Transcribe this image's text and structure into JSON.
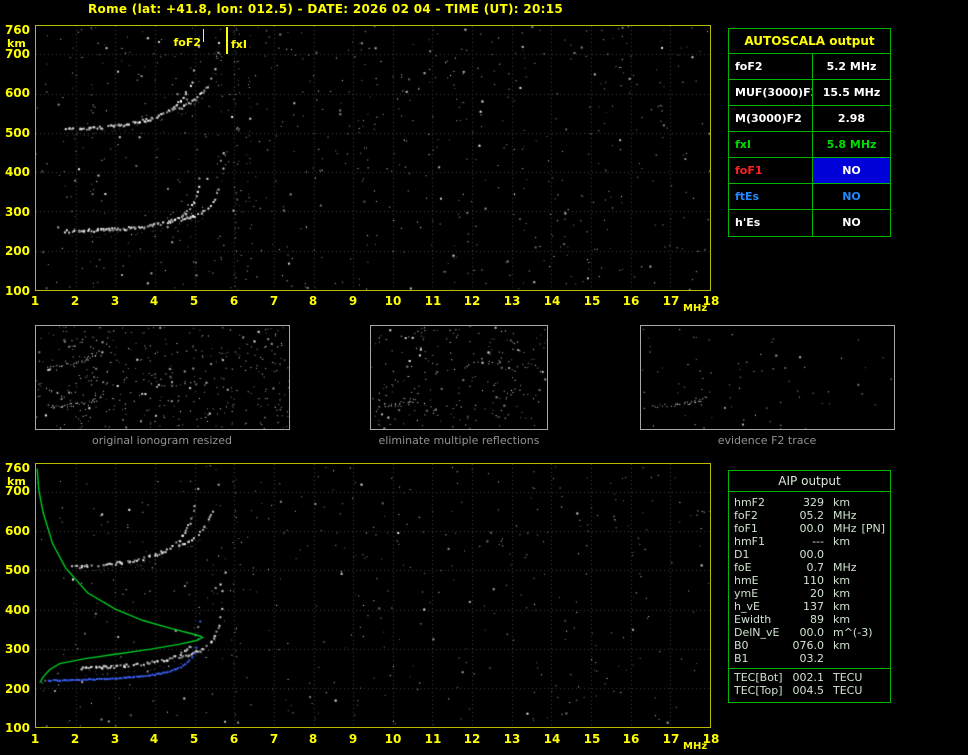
{
  "header": {
    "title": "Rome (lat: +41.8, lon: 012.5) - DATE: 2026 02 04 - TIME (UT): 20:15"
  },
  "colors": {
    "axis_yellow": "#ffff00",
    "plot_border": "#b9b900",
    "table_green": "#00b400",
    "trace_white": "#ffffff",
    "profile_green": "#00cc22",
    "fitted_blue": "#3c64ff",
    "fof1_red": "#ff2020",
    "es_blue": "#2288ff",
    "no_highlight_bg": "#0000d8",
    "caption_gray": "#929292",
    "aip_text": "#cfe2cf"
  },
  "axes": {
    "y_ticks": [
      760,
      700,
      600,
      500,
      400,
      300,
      200,
      100
    ],
    "y_unit": "km",
    "x_ticks": [
      1,
      2,
      3,
      4,
      5,
      6,
      7,
      8,
      9,
      10,
      11,
      12,
      13,
      14,
      15,
      16,
      17,
      18
    ],
    "x_unit": "MHz"
  },
  "top_plot": {
    "foF2_label": "foF2",
    "fxI_label": "fxI"
  },
  "autoscala": {
    "title": "AUTOSCALA output",
    "rows": [
      {
        "label": "foF2",
        "value": "5.2 MHz",
        "label_color": "#ffffff",
        "value_color": "#ffffff",
        "value_bg": ""
      },
      {
        "label": "MUF(3000)F2",
        "value": "15.5 MHz",
        "label_color": "#ffffff",
        "value_color": "#ffffff",
        "value_bg": ""
      },
      {
        "label": "M(3000)F2",
        "value": "2.98",
        "label_color": "#ffffff",
        "value_color": "#ffffff",
        "value_bg": ""
      },
      {
        "label": "fxI",
        "value": "5.8 MHz",
        "label_color": "#00dd00",
        "value_color": "#00dd00",
        "value_bg": ""
      },
      {
        "label": "foF1",
        "value": "NO",
        "label_color": "#ff2020",
        "value_color": "#ffffff",
        "value_bg": "#0000d8"
      },
      {
        "label": "ftEs",
        "value": "NO",
        "label_color": "#2288ff",
        "value_color": "#2288ff",
        "value_bg": ""
      },
      {
        "label": "h'Es",
        "value": "NO",
        "label_color": "#ffffff",
        "value_color": "#ffffff",
        "value_bg": ""
      }
    ]
  },
  "thumbnails": [
    {
      "caption": "original ionogram resized"
    },
    {
      "caption": "eliminate multiple reflections"
    },
    {
      "caption": "evidence F2 trace"
    }
  ],
  "aip": {
    "title": "AIP output",
    "rows": [
      {
        "label": "hmF2",
        "value": "329",
        "unit": "km",
        "note": ""
      },
      {
        "label": "foF2",
        "value": "05.2",
        "unit": "MHz",
        "note": ""
      },
      {
        "label": "foF1",
        "value": "00.0",
        "unit": "MHz",
        "note": "[PN]"
      },
      {
        "label": "hmF1",
        "value": "---",
        "unit": "km",
        "note": ""
      },
      {
        "label": "D1",
        "value": "00.0",
        "unit": "",
        "note": ""
      },
      {
        "label": "foE",
        "value": "0.7",
        "unit": "MHz",
        "note": ""
      },
      {
        "label": "hmE",
        "value": "110",
        "unit": "km",
        "note": ""
      },
      {
        "label": "ymE",
        "value": "20",
        "unit": "km",
        "note": ""
      },
      {
        "label": "h_vE",
        "value": "137",
        "unit": "km",
        "note": ""
      },
      {
        "label": "Ewidth",
        "value": "89",
        "unit": "km",
        "note": ""
      },
      {
        "label": "DelN_vE",
        "value": "00.0",
        "unit": "m^(-3)",
        "note": ""
      },
      {
        "label": "B0",
        "value": "076.0",
        "unit": "km",
        "note": ""
      },
      {
        "label": "B1",
        "value": "03.2",
        "unit": "",
        "note": ""
      },
      {
        "label": "TEC[Bot]",
        "value": "002.1",
        "unit": "TECU",
        "note": "",
        "sep": true
      },
      {
        "label": "TEC[Top]",
        "value": "004.5",
        "unit": "TECU",
        "note": ""
      }
    ]
  },
  "chart_data": [
    {
      "id": "top_ionogram",
      "type": "scatter",
      "title": "ionogram with AUTOSCALA interpretation",
      "xlabel": "MHz",
      "ylabel": "km",
      "xlim": [
        1,
        18
      ],
      "ylim": [
        100,
        760
      ],
      "grid": true,
      "key_values": {
        "foF2_MHz": 5.2,
        "fxI_MHz": 5.8,
        "MUF3000F2_MHz": 15.5,
        "M3000F2": 2.98
      },
      "annotations": [
        {
          "text": "foF2",
          "f_mhz": 5.2
        },
        {
          "text": "fxI",
          "f_mhz": 5.8
        }
      ],
      "traces": [
        {
          "name": "F2-first-hop-ordinary",
          "fc_mhz": 5.2,
          "f_start_mhz": 1.7,
          "h_base_km": 250,
          "steep": 32,
          "h_clip_km": 470
        },
        {
          "name": "F2-first-hop-extraordinary",
          "fc_mhz": 5.78,
          "f_start_mhz": 4.55,
          "h_base_km": 258,
          "steep": 34,
          "h_clip_km": 505
        },
        {
          "name": "F2-second-hop-ordinary",
          "fc_mhz": 5.2,
          "f_start_mhz": 1.75,
          "h_base_km": 506,
          "steep": 64,
          "h_clip_km": 758
        },
        {
          "name": "F2-second-hop-extraordinary",
          "fc_mhz": 5.78,
          "f_start_mhz": 4.5,
          "h_base_km": 520,
          "steep": 68,
          "h_clip_km": 758
        }
      ]
    },
    {
      "id": "bottom_ionogram",
      "type": "scatter",
      "title": "ionogram with AIP electron density profile",
      "xlabel": "MHz",
      "ylabel": "km",
      "xlim": [
        1,
        18
      ],
      "ylim": [
        100,
        760
      ],
      "grid": true,
      "key_values": {
        "hmF2_km": 329,
        "foF2_MHz": 5.2,
        "foE_MHz": 0.7,
        "hmE_km": 110,
        "B0_km": 76.0,
        "B1": 3.2
      },
      "traces": [
        {
          "name": "F2-first-hop-ordinary",
          "fc_mhz": 5.2,
          "f_start_mhz": 2.1,
          "h_base_km": 250,
          "steep": 32,
          "h_clip_km": 470
        },
        {
          "name": "F2-first-hop-extraordinary",
          "fc_mhz": 5.78,
          "f_start_mhz": 4.6,
          "h_base_km": 258,
          "steep": 34,
          "h_clip_km": 505
        },
        {
          "name": "F2-second-hop-ordinary",
          "fc_mhz": 5.2,
          "f_start_mhz": 1.9,
          "h_base_km": 506,
          "steep": 64,
          "h_clip_km": 758
        },
        {
          "name": "F2-second-hop-extraordinary",
          "fc_mhz": 5.78,
          "f_start_mhz": 4.55,
          "h_base_km": 520,
          "steep": 68,
          "h_clip_km": 758
        }
      ],
      "fitted_trace": {
        "name": "restored-F2-trace",
        "fc_mhz": 5.2,
        "f_start_mhz": 1.3,
        "h_base_km": 220,
        "steep": 30,
        "h_clip_km": 445
      },
      "profile_points": [
        [
          1.03,
          760
        ],
        [
          1.07,
          706
        ],
        [
          1.18,
          648
        ],
        [
          1.42,
          568
        ],
        [
          1.75,
          506
        ],
        [
          2.3,
          443
        ],
        [
          3.0,
          401
        ],
        [
          3.7,
          372
        ],
        [
          4.4,
          352
        ],
        [
          4.9,
          339
        ],
        [
          5.15,
          332
        ],
        [
          5.2,
          329
        ],
        [
          5.05,
          321
        ],
        [
          4.6,
          311
        ],
        [
          3.9,
          299
        ],
        [
          3.0,
          286
        ],
        [
          2.2,
          274
        ],
        [
          1.6,
          262
        ],
        [
          1.35,
          247
        ],
        [
          1.18,
          228
        ],
        [
          1.1,
          213
        ]
      ]
    }
  ]
}
